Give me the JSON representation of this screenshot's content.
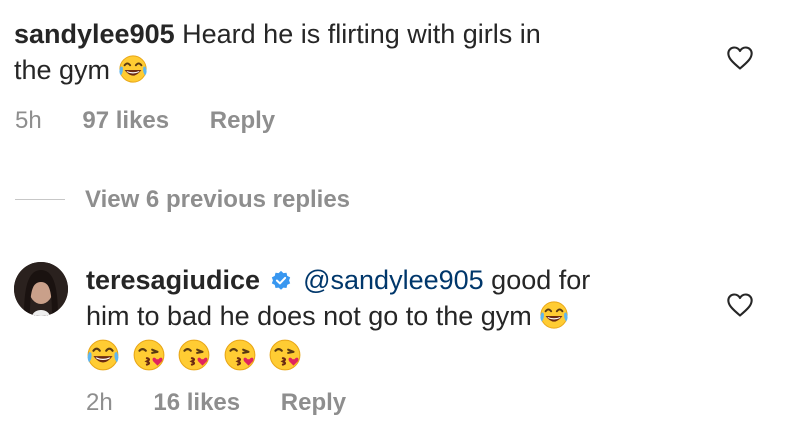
{
  "comment1": {
    "username": "sandylee905",
    "text_line1": "Heard he is flirting with girls in",
    "text_line2": "the gym",
    "emoji": "tears-of-joy",
    "time": "5h",
    "likes": "97 likes",
    "reply": "Reply"
  },
  "view_replies": "View 6 previous replies",
  "comment2": {
    "username": "teresagiudice",
    "mention": "@sandylee905",
    "text_line1_rest": "good for",
    "text_line2": "him to bad he does not go to the gym",
    "emoji_trailing": "tears-of-joy",
    "emoji_row": [
      "tears-of-joy",
      "face-blowing-kiss",
      "face-blowing-kiss",
      "face-blowing-kiss",
      "face-blowing-kiss"
    ],
    "time": "2h",
    "likes": "16 likes",
    "reply": "Reply"
  },
  "colors": {
    "text": "#262626",
    "secondary": "#8e8e8e",
    "mention": "#00376b",
    "verified": "#3897f0"
  }
}
